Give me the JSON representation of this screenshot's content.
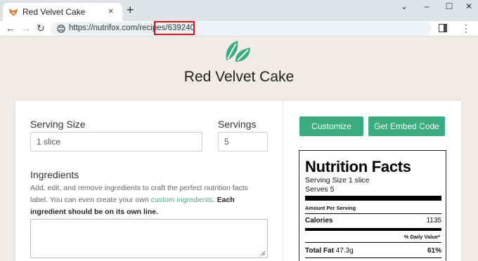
{
  "browser": {
    "tab_title": "Red Velvet Cake",
    "new_tab_glyph": "+",
    "close_glyph": "×",
    "url_base": "https://nutrifox.com/recipes/",
    "url_id": "639240",
    "window_controls": {
      "collapse": "⌄",
      "minimize": "–",
      "maximize": "☐",
      "close": "✕"
    },
    "nav": {
      "back": "←",
      "forward": "→",
      "reload": "↻",
      "menu": "⋮"
    }
  },
  "page": {
    "title": "Red Velvet Cake",
    "logo_color": "#3aaa80"
  },
  "form": {
    "serving_size_label": "Serving Size",
    "serving_size_value": "1 slice",
    "servings_label": "Servings",
    "servings_value": "5",
    "ingredients_label": "Ingredients",
    "help_line1": "Add, edit, and remove ingredients to craft the perfect nutrition facts label.",
    "help_line2_pre": "You can even create your own ",
    "help_link": "custom ingredients",
    "help_line2_post": ". ",
    "help_bold": "Each ingredient should be on its own line.",
    "ingredients_value": ""
  },
  "actions": {
    "customize_label": "Customize",
    "embed_label": "Get Embed Code",
    "accent_color": "#3aaa80"
  },
  "nutrition": {
    "title": "Nutrition Facts",
    "serving_size": "Serving Size 1 slice",
    "serves": "Serves 5",
    "amount_per_serving": "Amount Per Serving",
    "calories_label": "Calories",
    "calories_value": "1135",
    "daily_value_header": "% Daily Value*",
    "total_fat_label": "Total Fat",
    "total_fat_amount": "47.3g",
    "total_fat_dv": "61%"
  }
}
